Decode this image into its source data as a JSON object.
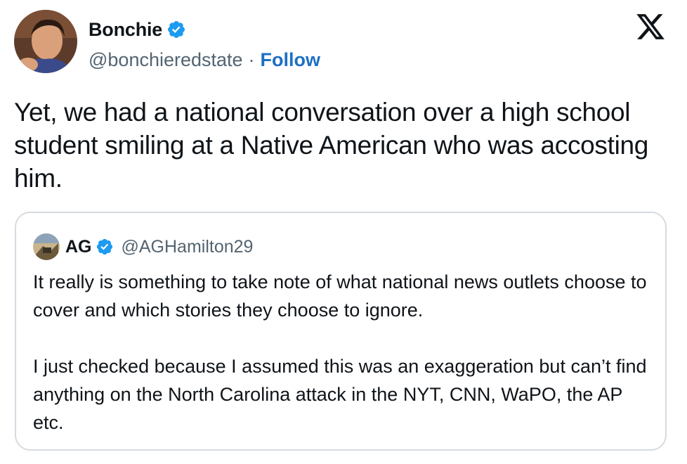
{
  "author": {
    "display_name": "Bonchie",
    "handle": "@bonchieredstate",
    "separator": "·",
    "follow_label": "Follow"
  },
  "tweet": {
    "text": "Yet, we had a national conversation over a high school student smiling at a Native American who was accosting him."
  },
  "quoted_tweet": {
    "display_name": "AG",
    "handle": "@AGHamilton29",
    "paragraph_1": "It really is something to take note of what national news outlets choose to cover and which stories they choose to ignore.",
    "paragraph_2": "I just checked because I assumed this was an exaggeration but can’t find anything on the North Carolina attack  in the NYT, CNN, WaPO, the AP etc."
  },
  "icons": {
    "verified": "verified-badge-icon",
    "platform": "x-logo-icon"
  },
  "colors": {
    "verified_blue": "#1d9bf0",
    "follow_blue": "#1d6fc4",
    "secondary_text": "#536471",
    "border": "#d6dbe0"
  }
}
